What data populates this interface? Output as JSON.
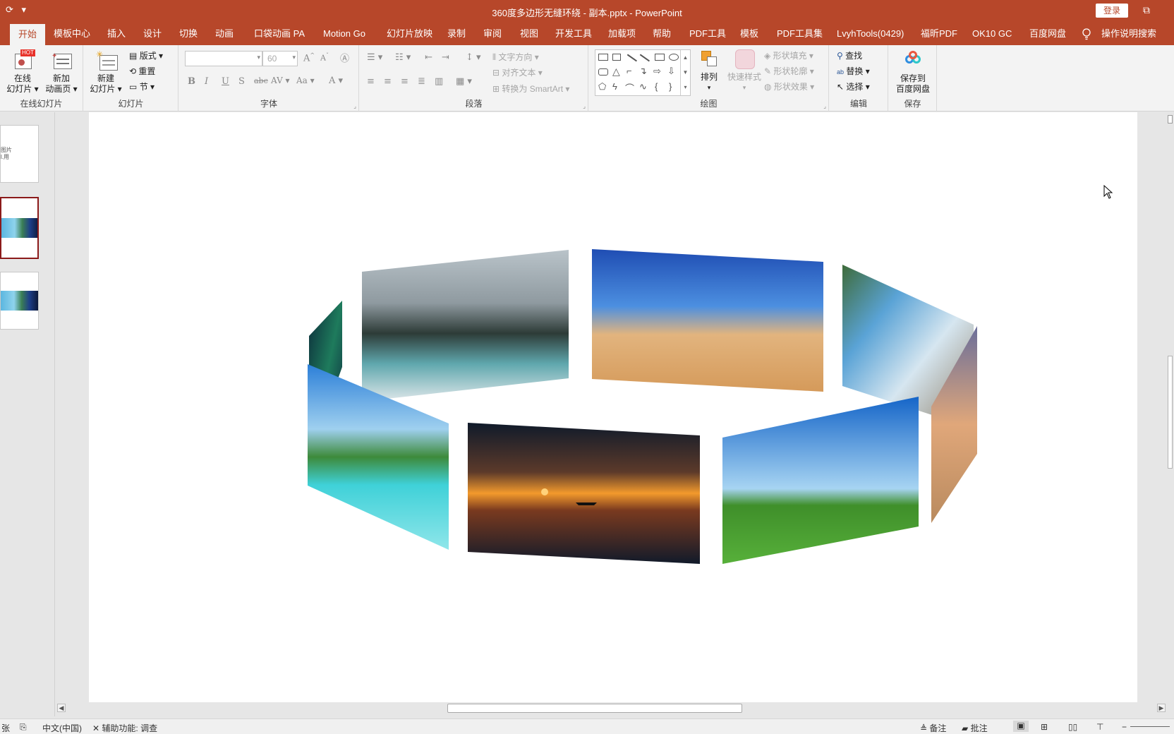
{
  "titlebar": {
    "title": "360度多边形无缝环绕 - 副本.pptx  -  PowerPoint",
    "login": "登录",
    "qat_icons": [
      "restore-icon",
      "customize-qat-icon"
    ]
  },
  "tabs": [
    {
      "label": "开始",
      "active": true
    },
    {
      "label": "模板中心"
    },
    {
      "label": "插入"
    },
    {
      "label": "设计"
    },
    {
      "label": "切换"
    },
    {
      "label": "动画"
    },
    {
      "label": "口袋动画 PA"
    },
    {
      "label": "Motion Go"
    },
    {
      "label": "幻灯片放映"
    },
    {
      "label": "录制"
    },
    {
      "label": "审阅"
    },
    {
      "label": "视图"
    },
    {
      "label": "开发工具"
    },
    {
      "label": "加载项"
    },
    {
      "label": "帮助"
    },
    {
      "label": "PDF工具"
    },
    {
      "label": "模板"
    },
    {
      "label": "PDF工具集"
    },
    {
      "label": "LvyhTools(0429)"
    },
    {
      "label": "福昕PDF"
    },
    {
      "label": "OK10 GC"
    },
    {
      "label": "百度网盘"
    },
    {
      "label": "操作说明搜索"
    }
  ],
  "ribbon": {
    "online": {
      "btn1": "在线",
      "btn1b": "幻灯片",
      "btn2": "新加",
      "btn2b": "动画页",
      "hot": "HOT",
      "label": "在线幻灯片"
    },
    "slides": {
      "new1": "新建",
      "new2": "幻灯片",
      "layout": "版式",
      "reset": "重置",
      "section": "节",
      "label": "幻灯片"
    },
    "font": {
      "size": "60",
      "label": "字体",
      "bold": "B",
      "italic": "I",
      "underline": "U",
      "shadow": "S",
      "strike": "abc",
      "spacing": "AV",
      "case": "Aa",
      "color": "A",
      "grow": "A",
      "shrink": "A"
    },
    "paragraph": {
      "text_direction": "文字方向",
      "align_text": "对齐文本",
      "smartart": "转换为 SmartArt",
      "label": "段落"
    },
    "drawing": {
      "arrange": "排列",
      "quick_styles": "快速样式",
      "fill": "形状填充",
      "outline": "形状轮廓",
      "effects": "形状效果",
      "label": "绘图"
    },
    "editing": {
      "find": "查找",
      "replace": "替换",
      "select": "选择",
      "label": "编辑"
    },
    "save": {
      "btn1": "保存到",
      "btn2": "百度网盘",
      "label": "保存"
    }
  },
  "thumbnails": {
    "slide1_text": [
      "图片",
      "l.用"
    ]
  },
  "status": {
    "slide_info": "张",
    "language": "中文(中国)",
    "accessibility": "辅助功能: 调查",
    "notes": "备注",
    "comments": "批注"
  },
  "colors": {
    "accent": "#b7472a",
    "ribbon_bg": "#f3f3f3",
    "selected_thumb_border": "#8b1a1a"
  }
}
